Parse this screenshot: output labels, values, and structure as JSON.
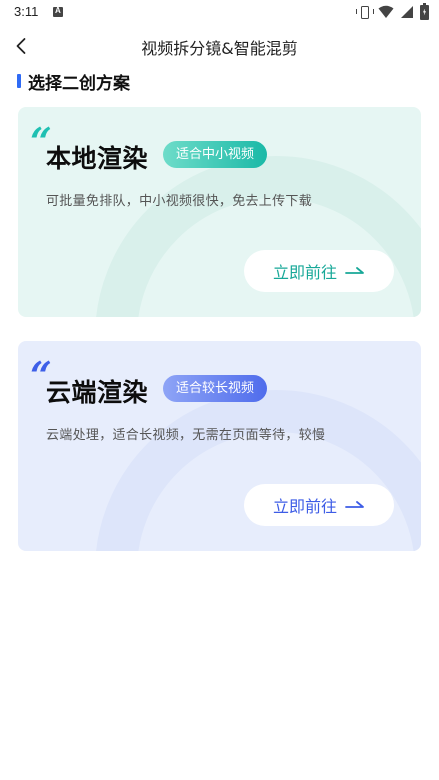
{
  "status_bar": {
    "time": "3:11",
    "icons": [
      "app-notification-icon",
      "vibrate-icon",
      "wifi-icon",
      "signal-icon",
      "battery-charging-icon"
    ]
  },
  "header": {
    "title": "视频拆分镜&智能混剪",
    "back_icon": "chevron-left-icon"
  },
  "section": {
    "title": "选择二创方案",
    "accent_color": "#2f6bf5"
  },
  "cards": [
    {
      "id": "local",
      "quote": "“",
      "title": "本地渲染",
      "tag": "适合中小视频",
      "description": "可批量免排队，中小视频很快，免去上传下载",
      "button_label": "立即前往",
      "accent_color": "#1ab9a7",
      "background_color": "#e6f6f3"
    },
    {
      "id": "cloud",
      "quote": "“",
      "title": "云端渲染",
      "tag": "适合较长视频",
      "description": "云端处理，适合长视频，无需在页面等待，较慢",
      "button_label": "立即前往",
      "accent_color": "#4f6cec",
      "background_color": "#e7edfc"
    }
  ]
}
